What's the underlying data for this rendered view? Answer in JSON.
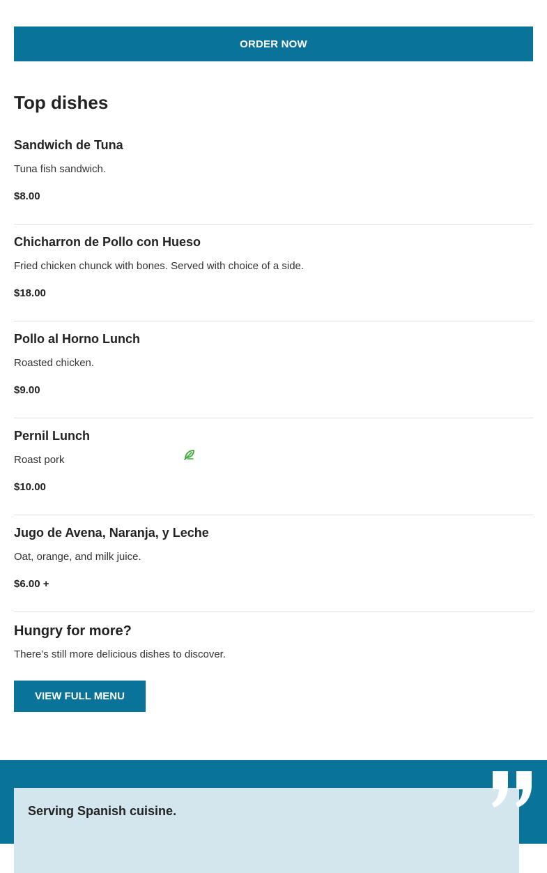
{
  "order": {
    "label": "ORDER NOW"
  },
  "top_dishes": {
    "title": "Top dishes",
    "items": [
      {
        "name": "Sandwich de Tuna",
        "description": "Tuna fish sandwich.",
        "price": "$8.00"
      },
      {
        "name": "Chicharron de Pollo con Hueso",
        "description": "Fried chicken chunck with bones. Served with choice of a side.",
        "price": "$18.00"
      },
      {
        "name": "Pollo al Horno Lunch",
        "description": "Roasted chicken.",
        "price": "$9.00"
      },
      {
        "name": "Pernil Lunch",
        "description": "Roast pork",
        "price": "$10.00"
      },
      {
        "name": "Jugo de Avena, Naranja, y Leche",
        "description": "Oat, orange, and milk juice.",
        "price": "$6.00 +",
        "icon": "leaf-icon"
      }
    ]
  },
  "more": {
    "title": "Hungry for more?",
    "text": "There’s still more delicious dishes to discover.",
    "button_label": "VIEW FULL MENU"
  },
  "about": {
    "quote": "Serving Spanish cuisine.",
    "icon": "quote-icon"
  },
  "colors": {
    "brand": "#0a7399",
    "card": "#d4e6ed",
    "leaf": "#3aa935"
  }
}
